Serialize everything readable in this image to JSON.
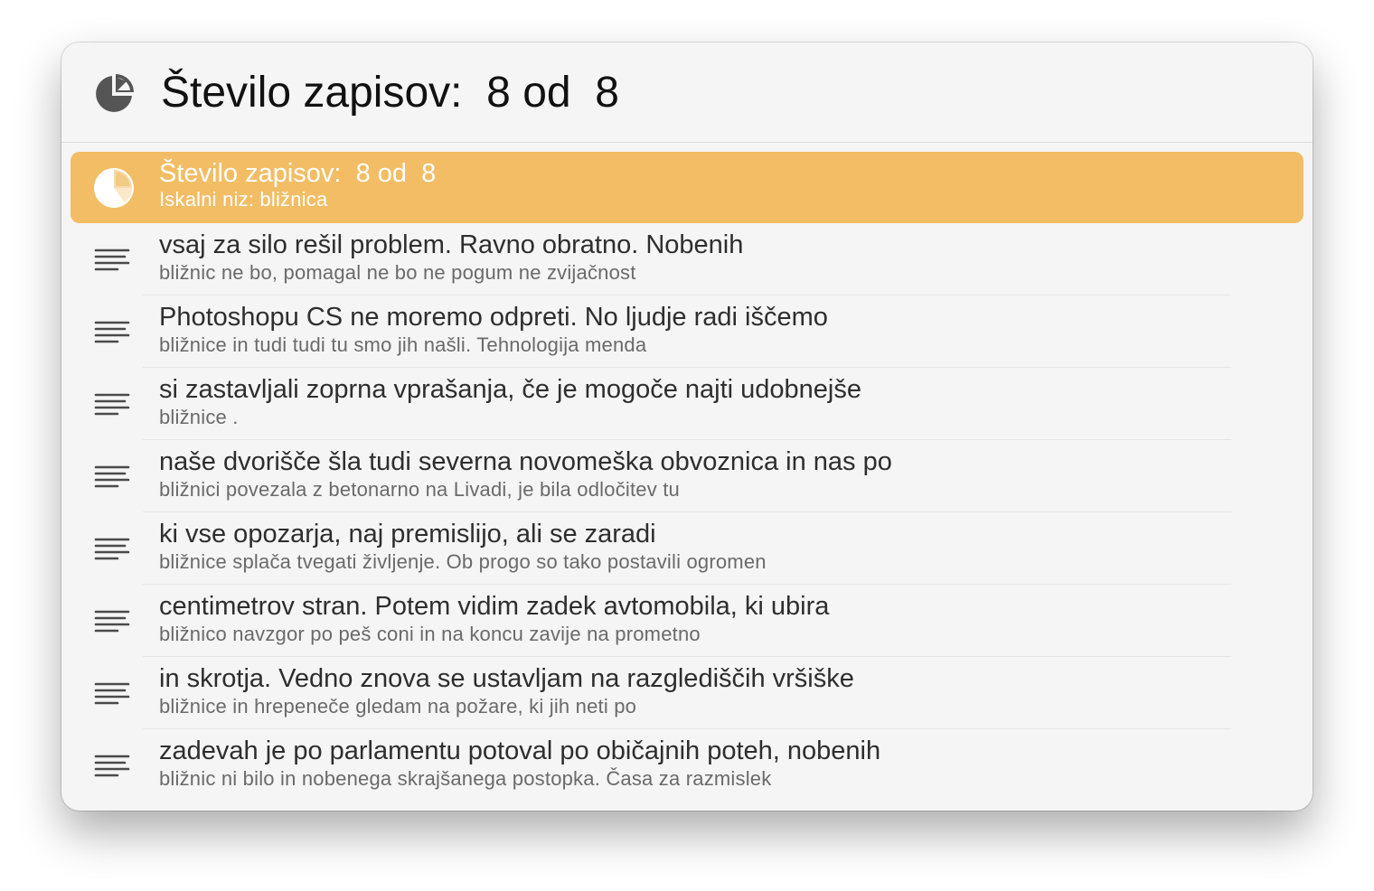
{
  "header": {
    "icon": "pie-chart-icon",
    "title": "Število zapisov:  8 od  8"
  },
  "summary_row": {
    "icon": "pie-chart-icon",
    "title": "Število zapisov:  8 od  8",
    "subtitle": "Iskalni niz: bližnica",
    "accent_color": "#f2bd64"
  },
  "results": [
    {
      "icon": "text-lines-icon",
      "title": "vsaj za silo rešil problem. Ravno obratno. Nobenih",
      "subtitle": "bližnic ne bo, pomagal ne bo ne pogum ne zvijačnost"
    },
    {
      "icon": "text-lines-icon",
      "title": "Photoshopu CS ne moremo odpreti. No ljudje radi iščemo",
      "subtitle": "bližnice in tudi tudi tu smo jih našli. Tehnologija menda"
    },
    {
      "icon": "text-lines-icon",
      "title": "si zastavljali zoprna vprašanja, če je mogoče najti udobnejše",
      "subtitle": "bližnice ."
    },
    {
      "icon": "text-lines-icon",
      "title": "naše dvorišče šla tudi severna novomeška obvoznica in nas po",
      "subtitle": "bližnici povezala z betonarno na Livadi, je bila odločitev tu"
    },
    {
      "icon": "text-lines-icon",
      "title": "ki vse opozarja, naj premislijo, ali se zaradi",
      "subtitle": "bližnice splača tvegati življenje. Ob progo so tako postavili ogromen"
    },
    {
      "icon": "text-lines-icon",
      "title": "centimetrov stran. Potem vidim zadek avtomobila, ki ubira",
      "subtitle": "bližnico navzgor po peš coni in na koncu zavije na prometno"
    },
    {
      "icon": "text-lines-icon",
      "title": "in skrotja. Vedno znova se ustavljam na razglediščih vršiške",
      "subtitle": "bližnice in hrepeneče gledam na požare, ki jih neti po"
    },
    {
      "icon": "text-lines-icon",
      "title": "zadevah je po parlamentu potoval po običajnih poteh, nobenih",
      "subtitle": "bližnic ni bilo in nobenega skrajšanega postopka. Časa za razmislek"
    }
  ]
}
